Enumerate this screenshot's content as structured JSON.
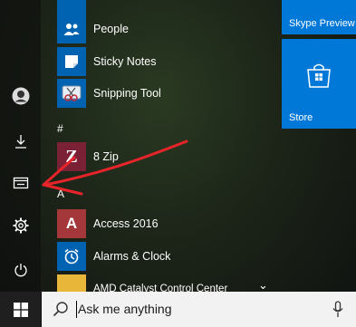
{
  "rail": {
    "items": [
      {
        "name": "user-avatar",
        "icon": "user-icon"
      },
      {
        "name": "downloads",
        "icon": "download-icon"
      },
      {
        "name": "file-explorer",
        "icon": "folder-icon"
      },
      {
        "name": "settings",
        "icon": "gear-icon"
      },
      {
        "name": "power",
        "icon": "power-icon"
      }
    ]
  },
  "apps": {
    "items": [
      {
        "label": "",
        "icon": "app-icon"
      },
      {
        "label": "People",
        "icon": "people-icon"
      },
      {
        "label": "Sticky Notes",
        "icon": "sticky-notes-icon"
      },
      {
        "label": "Snipping Tool",
        "icon": "scissors-icon"
      },
      {
        "label": "8 Zip",
        "icon": "zip-icon"
      },
      {
        "label": "Access 2016",
        "icon": "access-icon"
      },
      {
        "label": "Alarms & Clock",
        "icon": "alarm-clock-icon"
      },
      {
        "label": "AMD Catalyst Control Center",
        "icon": "folder-icon"
      }
    ],
    "headers": {
      "hash": "#",
      "a": "A"
    },
    "expand_glyph": "⌄"
  },
  "tiles": {
    "skype_label": "Skype Preview",
    "store_label": "Store"
  },
  "taskbar": {
    "search_placeholder": "Ask me anything"
  },
  "colors": {
    "accent": "#0078d7",
    "tile_icon": "#0063b1",
    "access_red": "#a4373a",
    "annotation_red": "#e8242b"
  }
}
